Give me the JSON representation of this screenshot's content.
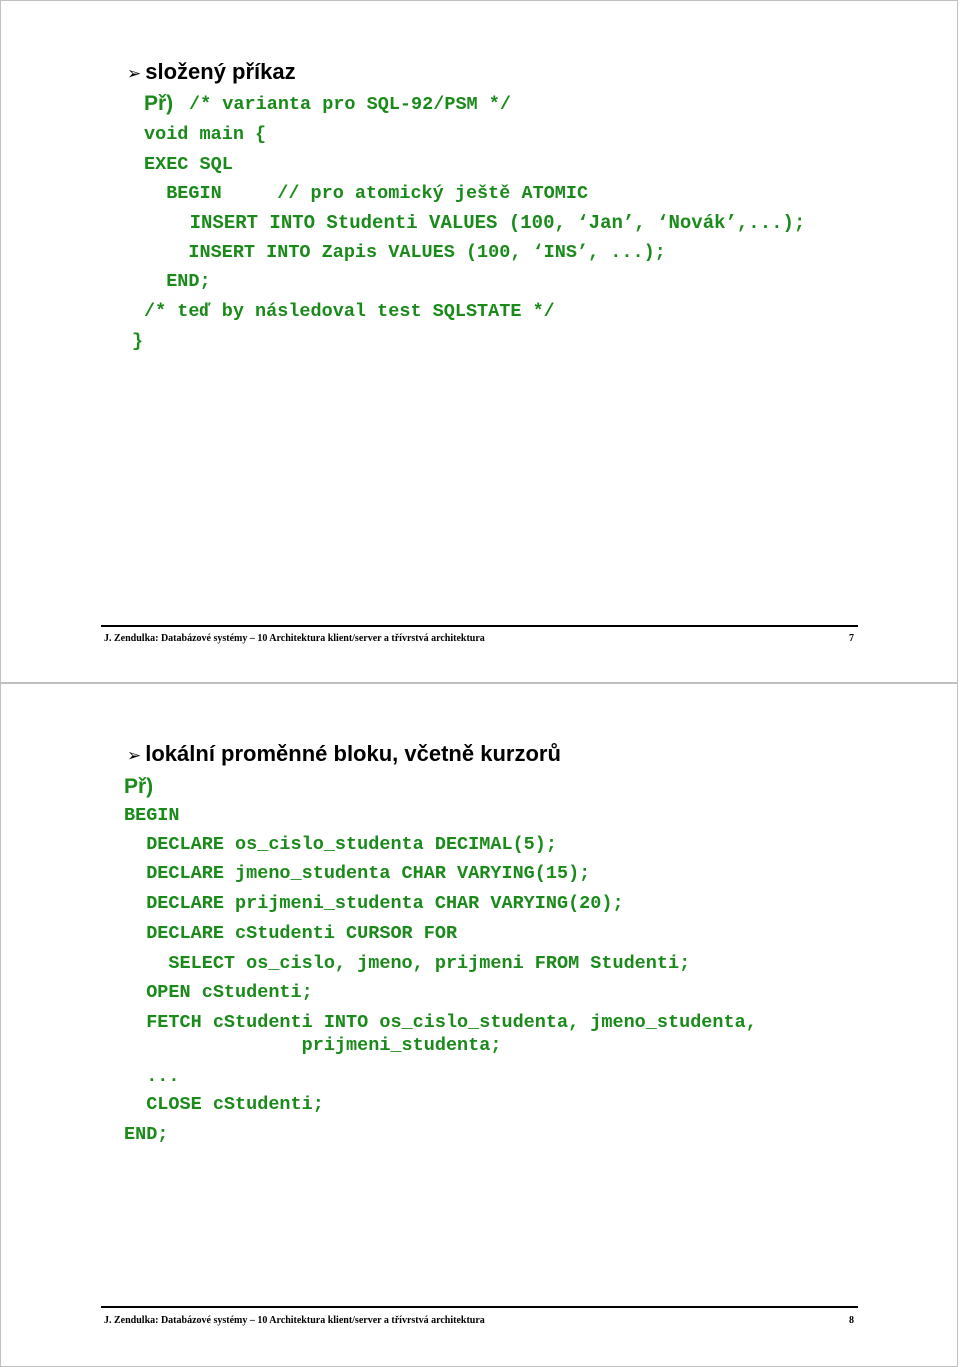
{
  "pages": [
    {
      "heading": "složený příkaz",
      "bullet_icon": "arrow-bullet-icon",
      "example_label": "Př)",
      "lines": [
        "/* varianta pro SQL-92/PSM */",
        "void main {",
        "EXEC SQL",
        "  BEGIN     // pro atomický ještě ATOMIC",
        "    INSERT INTO Studenti VALUES (100, ‘Jan’, ‘Novák’,...);",
        "    INSERT INTO Zapis VALUES (100, ‘INS’, ...);",
        "  END;",
        "/* teď by následoval test SQLSTATE */",
        "}"
      ],
      "footer": {
        "text": "J. Zendulka: Databázové systémy – 10 Architektura klient/server a třívrstvá architektura",
        "page_number": "7"
      }
    },
    {
      "heading": "lokální proměnné bloku, včetně kurzorů",
      "bullet_icon": "arrow-bullet-icon",
      "example_label": "Př)",
      "lines": [
        "BEGIN",
        "  DECLARE os_cislo_studenta DECIMAL(5);",
        "  DECLARE jmeno_studenta CHAR VARYING(15);",
        "  DECLARE prijmeni_studenta CHAR VARYING(20);",
        "  DECLARE cStudenti CURSOR FOR",
        "    SELECT os_cislo, jmeno, prijmeni FROM Studenti;",
        "  OPEN cStudenti;",
        "  FETCH cStudenti INTO os_cislo_studenta, jmeno_studenta,",
        "                prijmeni_studenta;",
        "  ...",
        "  CLOSE cStudenti;",
        "END;"
      ],
      "footer": {
        "text": "J. Zendulka: Databázové systémy – 10 Architektura klient/server a třívrstvá architektura",
        "page_number": "8"
      }
    }
  ],
  "colors": {
    "code_green": "#1a8a1a",
    "text": "#000000",
    "page_border": "#c0c0c0"
  }
}
